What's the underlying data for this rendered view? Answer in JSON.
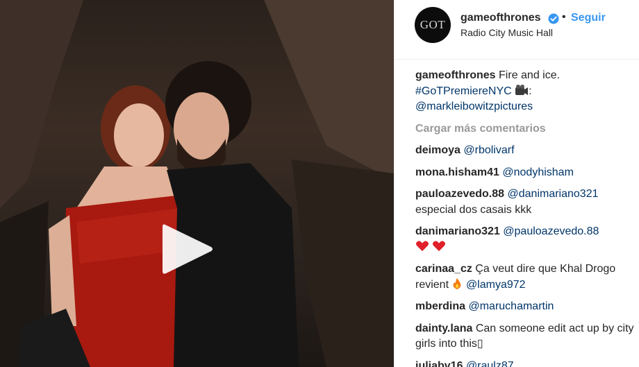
{
  "header": {
    "avatar_text": "GOT",
    "username": "gameofthrones",
    "separator": "•",
    "follow_label": "Seguir",
    "location": "Radio City Music Hall"
  },
  "caption": {
    "username": "gameofthrones",
    "text": "Fire and ice.",
    "hashtag": "#GoTPremiereNYC",
    "emoji": "movie-camera-icon",
    "colon": ":",
    "mention": "@markleibowitzpictures"
  },
  "load_more_label": "Cargar más comentarios",
  "comments": [
    {
      "username": "deimoya",
      "text": "",
      "mention": "@rbolivarf"
    },
    {
      "username": "mona.hisham41",
      "text": "",
      "mention": "@nodyhisham"
    },
    {
      "username": "pauloazevedo.88",
      "mention": "@danimariano321",
      "text": "especial dos casais kkk"
    },
    {
      "username": "danimariano321",
      "mention": "@pauloazevedo.88",
      "emoji": "two-hearts"
    },
    {
      "username": "carinaa_cz",
      "text": "Ça veut dire que Khal Drogo revient",
      "emoji": "fire",
      "mention": "@lamya972"
    },
    {
      "username": "mberdina",
      "text": "",
      "mention": "@maruchamartin"
    },
    {
      "username": "dainty.lana",
      "text": "Can someone edit act up by city girls into this▯"
    },
    {
      "username": "juliabv16",
      "text": "",
      "mention": "@raulz87"
    }
  ],
  "colors": {
    "link": "#003569",
    "follow": "#3897f0",
    "verified": "#3897f0",
    "muted": "#999999"
  }
}
